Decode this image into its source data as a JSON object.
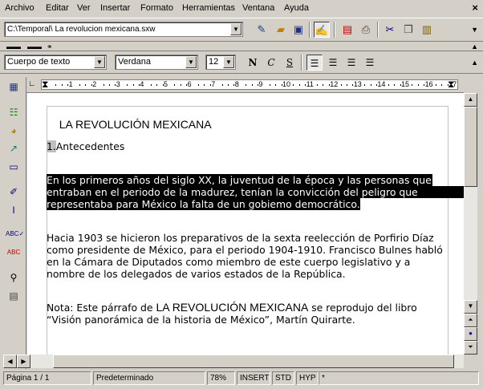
{
  "menu": [
    "Archivo",
    "Editar",
    "Ver",
    "Insertar",
    "Formato",
    "Herramientas",
    "Ventana",
    "Ayuda"
  ],
  "url_value": "C:\\Temporal\\ La revolucion mexicana.sxw",
  "paragraph_style": "Cuerpo de texto",
  "font_name": "Verdana",
  "font_size": "12",
  "format_buttons": {
    "bold": "N",
    "italic": "C",
    "underline": "S"
  },
  "ruler_numbers": [
    "1",
    "2",
    "3",
    "4",
    "5",
    "6",
    "7",
    "8",
    "9",
    "10",
    "11",
    "12",
    "13",
    "14",
    "15",
    "16",
    "17"
  ],
  "document": {
    "title": "LA REVOLUCIÓN MEXICANA",
    "heading_number": "1.",
    "heading_text": "Antecedentes",
    "selected_lines": [
      "En los primeros años del siglo XX, la juventud de la época y las personas que",
      "entraban en el periodo de la madurez, tenían la convicción del peligro que",
      "representaba para México la falta de un gobiemo democrático."
    ],
    "para2_lines": [
      "Hacia 1903 se hicieron los preparativos de la sexta reelección de Porfirio Díaz",
      "como presidente de México, para el periodo 1904-1910. Francisco Bulnes habló",
      "en la Cámara de Diputados como miembro de este cuerpo legislativo y a",
      "nombre de los delegados de varios estados de la República."
    ],
    "note_prefix": "Nota: Este párrafo de ",
    "note_title": "LA REVOLUCIÓN MEXICANA",
    "note_suffix": " se reprodujo del libro",
    "note_line2": "“Visión panorámica de la historia de México”, Martín Quirarte."
  },
  "status": {
    "page": "Página  1 / 1",
    "style": "Predeterminado",
    "zoom": "78%",
    "insert": "INSERT",
    "std": "STD",
    "hyp": "HYP",
    "modified": "*"
  },
  "colors": {
    "chrome": "#d4d0c8",
    "selection": "#000000",
    "page": "#ffffff"
  }
}
